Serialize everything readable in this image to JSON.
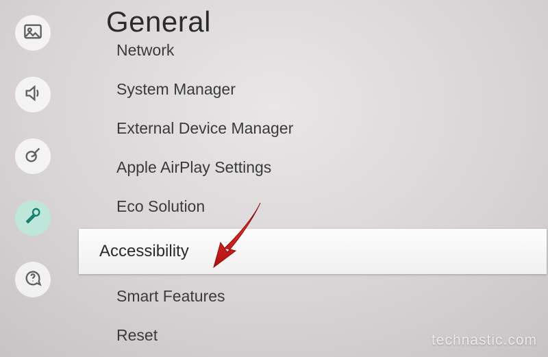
{
  "title": "General",
  "sidebar": {
    "items": [
      {
        "name": "picture",
        "active": false
      },
      {
        "name": "sound",
        "active": false
      },
      {
        "name": "broadcast",
        "active": false
      },
      {
        "name": "general",
        "active": true
      },
      {
        "name": "support",
        "active": false
      }
    ]
  },
  "menu": {
    "items": [
      {
        "label": "Network",
        "partial": true,
        "selected": false
      },
      {
        "label": "System Manager",
        "partial": false,
        "selected": false
      },
      {
        "label": "External Device Manager",
        "partial": false,
        "selected": false
      },
      {
        "label": "Apple AirPlay Settings",
        "partial": false,
        "selected": false
      },
      {
        "label": "Eco Solution",
        "partial": false,
        "selected": false
      },
      {
        "label": "Accessibility",
        "partial": false,
        "selected": true
      },
      {
        "label": "Smart Features",
        "partial": false,
        "selected": false
      },
      {
        "label": "Reset",
        "partial": false,
        "selected": false
      }
    ]
  },
  "watermark": "technastic.com",
  "annotation": {
    "arrow_color": "#e31b1b"
  }
}
